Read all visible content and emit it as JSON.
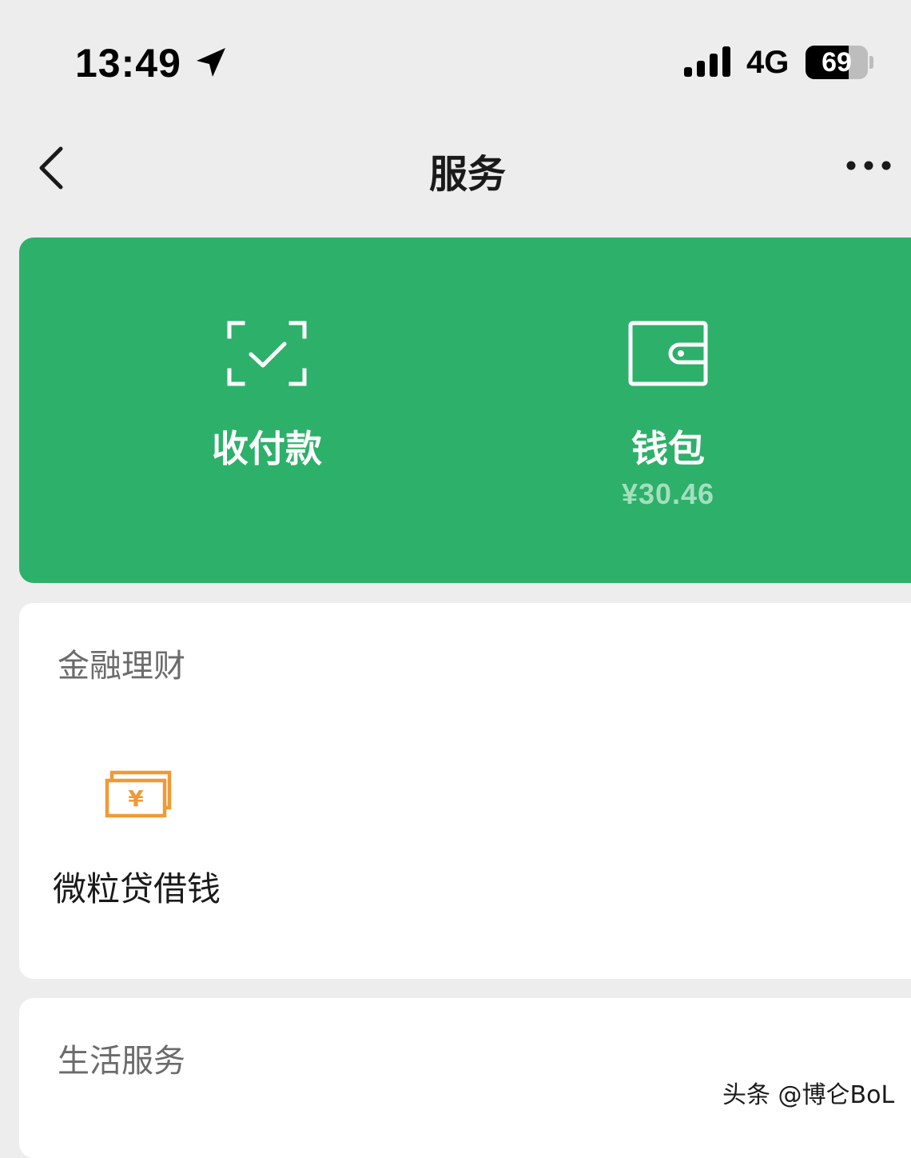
{
  "status_bar": {
    "time": "13:49",
    "network": "4G",
    "battery": "69",
    "battery_level": 0.69,
    "location_icon": "location-arrow-icon",
    "signal_icon": "cellular-signal-icon"
  },
  "nav": {
    "title": "服务",
    "back_icon": "chevron-left-icon",
    "more_icon": "more-dots-icon"
  },
  "top_card": {
    "background": "#2db06a",
    "items": [
      {
        "label": "收付款",
        "icon": "scan-check-icon"
      },
      {
        "label": "钱包",
        "sub": "¥30.46",
        "icon": "wallet-icon"
      }
    ]
  },
  "sections": [
    {
      "title": "金融理财",
      "items": [
        {
          "label": "微粒贷借钱",
          "icon": "cash-yuan-icon",
          "color": "#f09a37"
        }
      ]
    },
    {
      "title": "生活服务",
      "items": []
    }
  ],
  "watermark": "头条 @博仑BoL"
}
